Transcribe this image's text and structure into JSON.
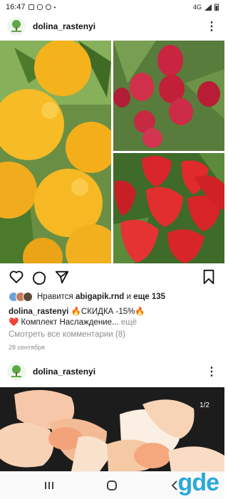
{
  "status_bar": {
    "time": "16:47",
    "network": "4G"
  },
  "post1": {
    "username": "dolina_rastenyi",
    "likes": {
      "prefix": "Нравится",
      "user": "abigapik.rnd",
      "conj": "и",
      "rest": "еще 135"
    },
    "caption": {
      "username": "dolina_rastenyi",
      "line1": "🔥СКИДКА -15%🔥",
      "line2": "❤️ Комплект Наслаждение...",
      "more": "ещё"
    },
    "comments_link": "Смотреть все комментарии (8)",
    "date": "28 сентября"
  },
  "post2": {
    "username": "dolina_rastenyi",
    "counter": "1/2"
  },
  "watermark": "gde",
  "icons": {
    "heart": "heart-icon",
    "comment": "comment-icon",
    "share": "share-icon",
    "bookmark": "bookmark-icon",
    "more": "more-icon",
    "nav_recent": "recent-apps-icon",
    "nav_home": "home-icon",
    "nav_back": "back-icon"
  },
  "colors": {
    "watermark": "#2aa8d8",
    "text_secondary": "#8e8e8e",
    "fire": "#e8552b"
  }
}
